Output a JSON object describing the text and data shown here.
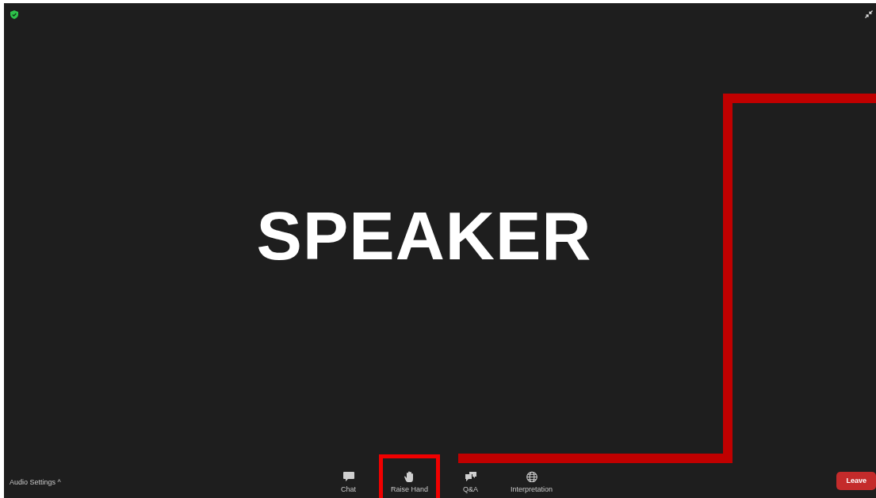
{
  "stage": {
    "speaker_label": "SPEAKER"
  },
  "toolbar": {
    "audio_settings": {
      "label": "Audio Settings",
      "caret": "^"
    },
    "items": [
      {
        "kind": "chat",
        "label": "Chat",
        "highlighted": false
      },
      {
        "kind": "hand",
        "label": "Raise Hand",
        "highlighted": true
      },
      {
        "kind": "qa",
        "label": "Q&A",
        "highlighted": false
      },
      {
        "kind": "globe",
        "label": "Interpretation",
        "highlighted": false
      }
    ],
    "leave_button": "Leave"
  }
}
